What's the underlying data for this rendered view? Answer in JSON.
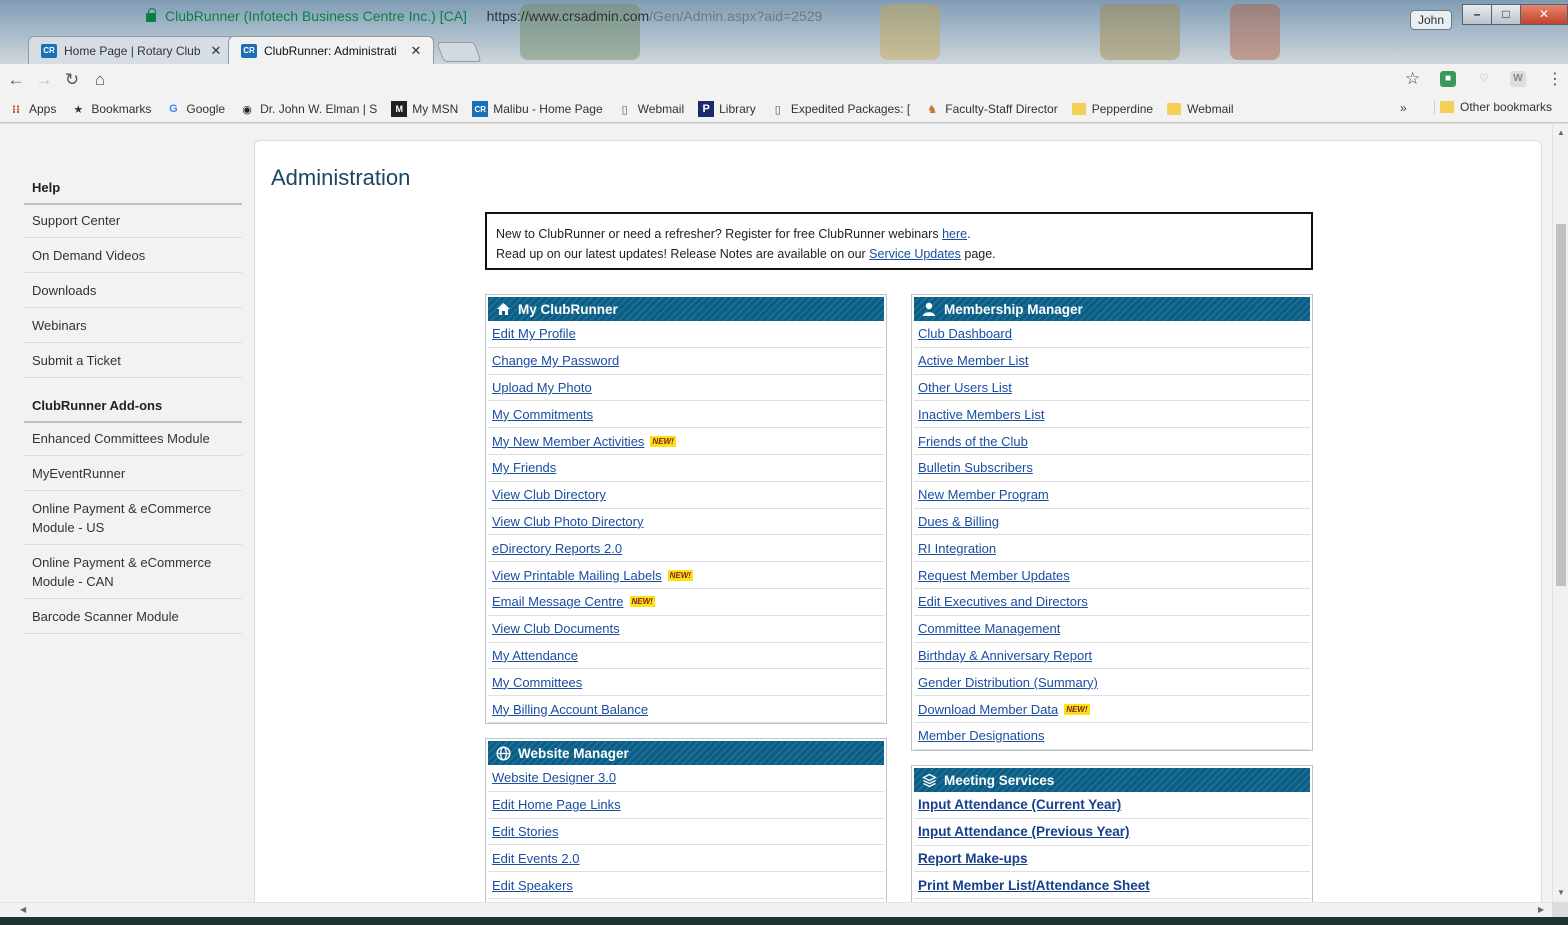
{
  "browser": {
    "tabs": [
      {
        "title": "Home Page | Rotary Club",
        "favicon": "CR",
        "active": false
      },
      {
        "title": "ClubRunner: Administrati",
        "favicon": "CR",
        "active": true
      }
    ],
    "user": "John",
    "address": {
      "secure_label": "ClubRunner (Infotech Business Centre Inc.) [CA]",
      "url_host": "https://www.crsadmin.com",
      "url_path": "/Gen/Admin.aspx?aid=2529"
    },
    "bookmarks": [
      {
        "label": "Apps",
        "icon": "apps-grid-icon"
      },
      {
        "label": "Bookmarks",
        "icon": "star-icon"
      },
      {
        "label": "Google",
        "icon": "google-icon"
      },
      {
        "label": "Dr. John W. Elman | S",
        "icon": "eye-icon"
      },
      {
        "label": "My MSN",
        "icon": "msn-icon"
      },
      {
        "label": "Malibu - Home Page",
        "icon": "cr-icon"
      },
      {
        "label": "Webmail",
        "icon": "page-icon"
      },
      {
        "label": "Library",
        "icon": "p-icon"
      },
      {
        "label": "Expedited Packages: [",
        "icon": "page-icon"
      },
      {
        "label": "Faculty-Staff Director",
        "icon": "crest-icon"
      },
      {
        "label": "Pepperdine",
        "icon": "folder-icon"
      },
      {
        "label": "Webmail",
        "icon": "folder-icon"
      }
    ],
    "bookmarks_more": "»",
    "other_bookmarks": "Other bookmarks"
  },
  "sidebar": {
    "help_heading": "Help",
    "help_items": [
      "Support Center",
      "On Demand Videos",
      "Downloads",
      "Webinars",
      "Submit a Ticket"
    ],
    "addons_heading": "ClubRunner Add-ons",
    "addon_items": [
      "Enhanced Committees Module",
      "MyEventRunner",
      "Online Payment & eCommerce Module - US",
      "Online Payment & eCommerce Module - CAN",
      "Barcode Scanner Module"
    ]
  },
  "main": {
    "title": "Administration",
    "notice": {
      "line1_text": "New to ClubRunner or need a refresher? Register for free ClubRunner webinars ",
      "line1_link": "here",
      "line1_end": ".",
      "line2_text": "Read up on our latest updates! Release Notes are available on our ",
      "line2_link": "Service Updates",
      "line2_end": " page."
    },
    "new_badge": "NEW!",
    "my_clubrunner": {
      "heading": "My ClubRunner",
      "icon": "home-icon",
      "links": [
        {
          "label": "Edit My Profile",
          "new": false
        },
        {
          "label": "Change My Password",
          "new": false
        },
        {
          "label": "Upload My Photo",
          "new": false
        },
        {
          "label": "My Commitments",
          "new": false
        },
        {
          "label": "My New Member Activities",
          "new": true
        },
        {
          "label": "My Friends",
          "new": false
        },
        {
          "label": "View Club Directory",
          "new": false
        },
        {
          "label": "View Club Photo Directory",
          "new": false
        },
        {
          "label": "eDirectory Reports 2.0",
          "new": false
        },
        {
          "label": "View Printable Mailing Labels",
          "new": true
        },
        {
          "label": "Email Message Centre",
          "new": true
        },
        {
          "label": "View Club Documents",
          "new": false
        },
        {
          "label": "My Attendance",
          "new": false
        },
        {
          "label": "My Committees",
          "new": false
        },
        {
          "label": "My Billing Account Balance",
          "new": false
        }
      ]
    },
    "website_manager": {
      "heading": "Website Manager",
      "icon": "globe-icon",
      "links": [
        {
          "label": "Website Designer 3.0",
          "new": false
        },
        {
          "label": "Edit Home Page Links",
          "new": false
        },
        {
          "label": "Edit Stories",
          "new": false
        },
        {
          "label": "Edit Events 2.0",
          "new": false
        },
        {
          "label": "Edit Speakers",
          "new": false
        }
      ]
    },
    "membership_manager": {
      "heading": "Membership Manager",
      "icon": "user-icon",
      "links": [
        {
          "label": "Club Dashboard",
          "new": false
        },
        {
          "label": "Active Member List",
          "new": false
        },
        {
          "label": "Other Users List",
          "new": false
        },
        {
          "label": "Inactive Members List",
          "new": false
        },
        {
          "label": "Friends of the Club",
          "new": false
        },
        {
          "label": "Bulletin Subscribers",
          "new": false
        },
        {
          "label": "New Member Program",
          "new": false
        },
        {
          "label": "Dues & Billing",
          "new": false
        },
        {
          "label": "RI Integration",
          "new": false
        },
        {
          "label": "Request Member Updates",
          "new": false
        },
        {
          "label": "Edit Executives and Directors",
          "new": false
        },
        {
          "label": "Committee Management",
          "new": false
        },
        {
          "label": "Birthday & Anniversary Report",
          "new": false
        },
        {
          "label": "Gender Distribution (Summary)",
          "new": false
        },
        {
          "label": "Download Member Data",
          "new": true
        },
        {
          "label": "Member Designations",
          "new": false
        }
      ]
    },
    "meeting_services": {
      "heading": "Meeting Services",
      "icon": "layers-icon",
      "links": [
        {
          "label": "Input Attendance (Current Year)",
          "new": false
        },
        {
          "label": "Input Attendance (Previous Year)",
          "new": false
        },
        {
          "label": "Report Make-ups",
          "new": false
        },
        {
          "label": "Print Member List/Attendance Sheet",
          "new": false
        }
      ]
    }
  },
  "colors": {
    "header_blue": "#0d5c83",
    "link_blue": "#1a4ea0",
    "new_badge_yellow": "#f7e21a"
  }
}
